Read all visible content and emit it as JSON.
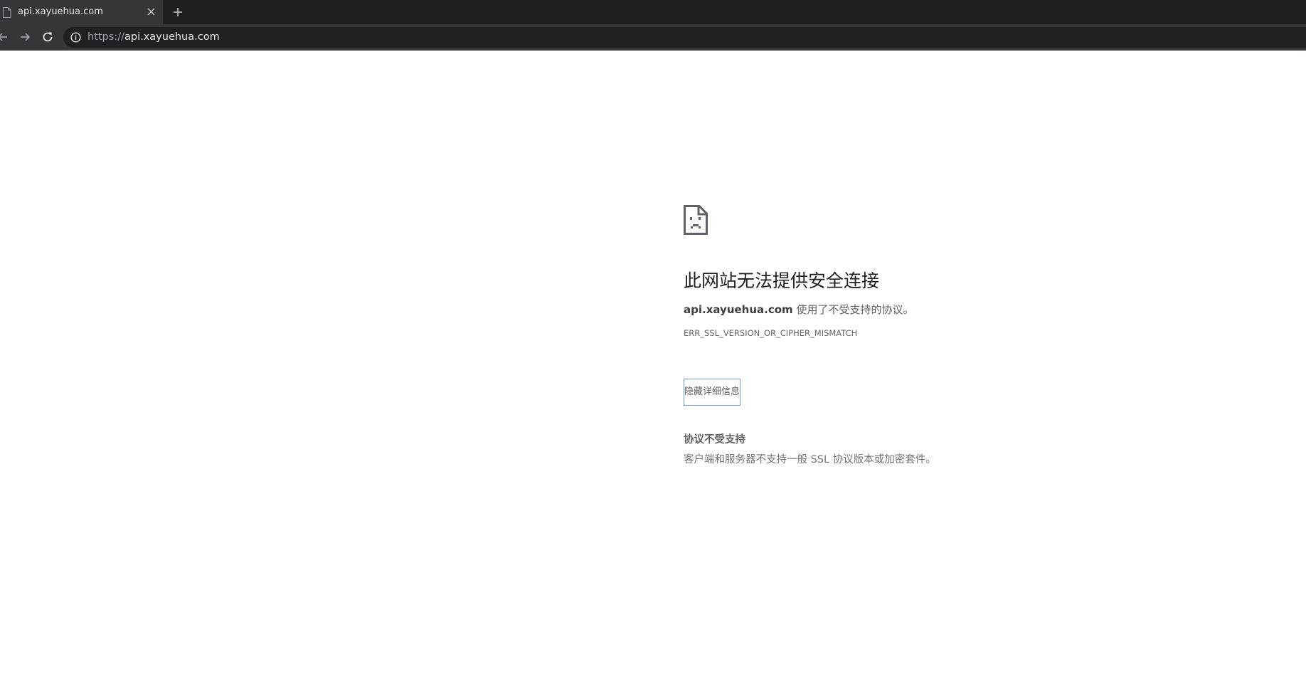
{
  "tab": {
    "title": "api.xayuehua.com",
    "favicon_icon": "page-icon",
    "close_icon": "close-icon"
  },
  "new_tab_icon": "plus-icon",
  "toolbar": {
    "back_icon": "arrow-left-icon",
    "forward_icon": "arrow-right-icon",
    "reload_icon": "reload-icon"
  },
  "omnibox": {
    "info_icon": "info-icon",
    "scheme": "https://",
    "host": "api.xayuehua.com"
  },
  "error_page": {
    "icon": "sad-document-icon",
    "heading": "此网站无法提供安全连接",
    "domain": "api.xayuehua.com",
    "summary_suffix": " 使用了不受支持的协议。",
    "error_code": "ERR_SSL_VERSION_OR_CIPHER_MISMATCH",
    "details_button_label": "隐藏详细信息",
    "details_title": "协议不受支持",
    "details_description": "客户端和服务器不支持一般 SSL 协议版本或加密套件。"
  },
  "colors": {
    "tabstrip": "#1f2023",
    "toolbar": "#35363a",
    "omnibox": "#202124",
    "button_border": "#6f9bd6"
  }
}
